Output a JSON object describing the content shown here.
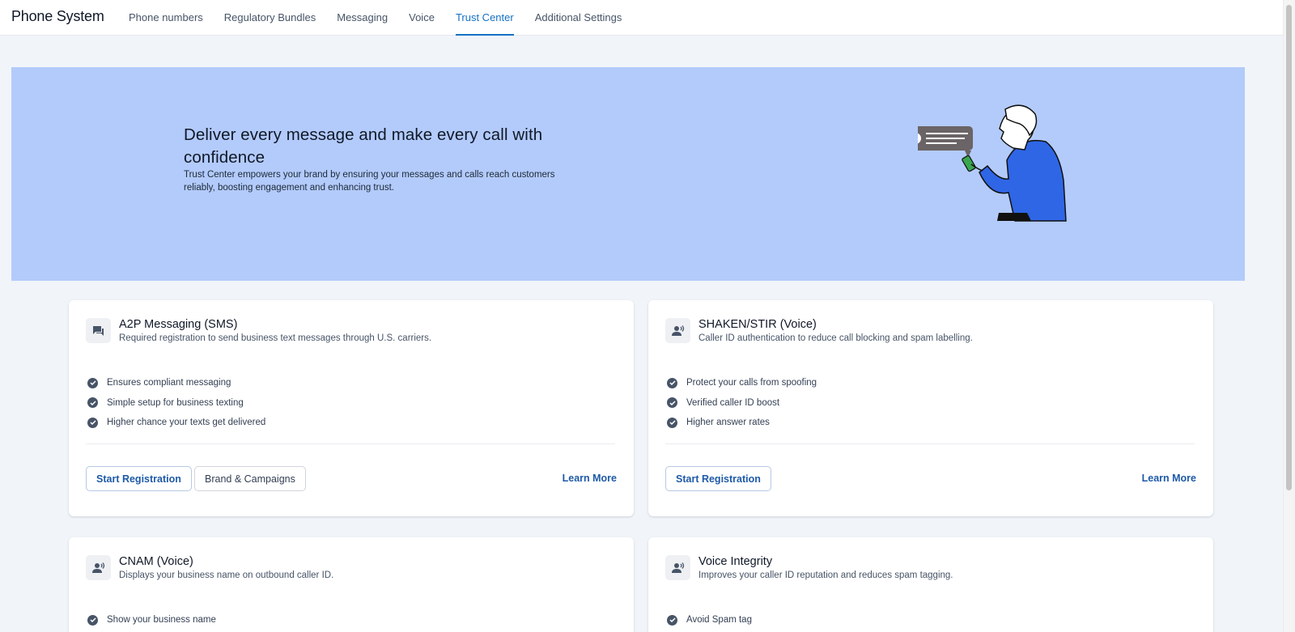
{
  "app": {
    "title": "Phone System"
  },
  "nav": {
    "tabs": [
      {
        "label": "Phone numbers"
      },
      {
        "label": "Regulatory Bundles"
      },
      {
        "label": "Messaging"
      },
      {
        "label": "Voice"
      },
      {
        "label": "Trust Center",
        "active": true
      },
      {
        "label": "Additional Settings"
      }
    ]
  },
  "hero": {
    "title": "Deliver every message and make every call with confidence",
    "subtitle": "Trust Center empowers your brand by ensuring your messages and calls reach customers reliably, boosting engagement and enhancing trust."
  },
  "cards": [
    {
      "icon": "chat-icon",
      "title": "A2P Messaging (SMS)",
      "subtitle": "Required registration to send business text messages through U.S. carriers.",
      "features": [
        "Ensures compliant messaging",
        "Simple setup for business texting",
        "Higher chance your texts get delivered"
      ],
      "primary_button": "Start Registration",
      "secondary_button": "Brand & Campaigns",
      "link": "Learn More"
    },
    {
      "icon": "caller-icon",
      "title": "SHAKEN/STIR (Voice)",
      "subtitle": "Caller ID authentication to reduce call blocking and spam labelling.",
      "features": [
        "Protect your calls from spoofing",
        "Verified caller ID boost",
        "Higher answer rates"
      ],
      "primary_button": "Start Registration",
      "link": "Learn More"
    },
    {
      "icon": "caller-icon",
      "title": "CNAM (Voice)",
      "subtitle": "Displays your business name on outbound caller ID.",
      "features": [
        "Show your business name"
      ]
    },
    {
      "icon": "caller-icon",
      "title": "Voice Integrity",
      "subtitle": "Improves your caller ID reputation and reduces spam tagging.",
      "features": [
        "Avoid Spam tag"
      ]
    }
  ],
  "colors": {
    "accent": "#1570c4",
    "hero_bg": "#b3cbfb",
    "page_bg": "#f1f5f9",
    "illustration_blue": "#2f66e6"
  }
}
